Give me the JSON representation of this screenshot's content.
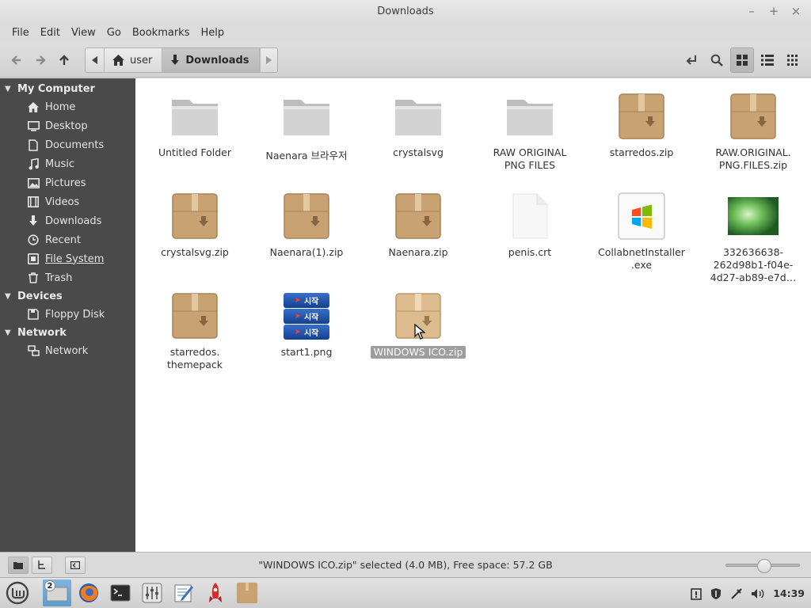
{
  "window": {
    "title": "Downloads",
    "controls": {
      "minimize": "–",
      "maximize": "+",
      "close": "×"
    }
  },
  "menubar": [
    "File",
    "Edit",
    "View",
    "Go",
    "Bookmarks",
    "Help"
  ],
  "toolbar": {
    "breadcrumbs": [
      {
        "label": "user",
        "icon": "home-icon"
      },
      {
        "label": "Downloads",
        "icon": "download-icon"
      }
    ]
  },
  "sidebar": {
    "sections": [
      {
        "title": "My Computer",
        "items": [
          {
            "label": "Home",
            "icon": "home-icon"
          },
          {
            "label": "Desktop",
            "icon": "desktop-icon"
          },
          {
            "label": "Documents",
            "icon": "documents-icon"
          },
          {
            "label": "Music",
            "icon": "music-icon"
          },
          {
            "label": "Pictures",
            "icon": "pictures-icon"
          },
          {
            "label": "Videos",
            "icon": "videos-icon"
          },
          {
            "label": "Downloads",
            "icon": "download-icon"
          },
          {
            "label": "Recent",
            "icon": "recent-icon"
          },
          {
            "label": "File System",
            "icon": "filesystem-icon"
          },
          {
            "label": "Trash",
            "icon": "trash-icon"
          }
        ]
      },
      {
        "title": "Devices",
        "items": [
          {
            "label": "Floppy Disk",
            "icon": "floppy-icon"
          }
        ]
      },
      {
        "title": "Network",
        "items": [
          {
            "label": "Network",
            "icon": "network-icon"
          }
        ]
      }
    ]
  },
  "files": [
    {
      "name": "Untitled Folder",
      "type": "folder"
    },
    {
      "name": "Naenara 브라우저",
      "type": "folder"
    },
    {
      "name": "crystalsvg",
      "type": "folder"
    },
    {
      "name": "RAW ORIGINAL PNG FILES",
      "type": "folder"
    },
    {
      "name": "starredos.zip",
      "type": "archive"
    },
    {
      "name": "RAW.ORIGINAL.\nPNG.FILES.zip",
      "type": "archive"
    },
    {
      "name": "crystalsvg.zip",
      "type": "archive"
    },
    {
      "name": "Naenara(1).zip",
      "type": "archive"
    },
    {
      "name": "Naenara.zip",
      "type": "archive"
    },
    {
      "name": "penis.crt",
      "type": "document"
    },
    {
      "name": "CollabnetInstaller\n.exe",
      "type": "exe"
    },
    {
      "name": "332636638-\n262d98b1-f04e-\n4d27-ab89-e7d…",
      "type": "image"
    },
    {
      "name": "starredos.\nthemepack",
      "type": "archive"
    },
    {
      "name": "start1.png",
      "type": "start-image",
      "button_text": "시작"
    },
    {
      "name": "WINDOWS ICO.zip",
      "type": "archive",
      "selected": true
    }
  ],
  "statusbar": {
    "text": "\"WINDOWS ICO.zip\" selected (4.0 MB), Free space: 57.2 GB",
    "zoom_level": 0.52
  },
  "taskbar": {
    "workspace_badge": "2",
    "clock": "14:39"
  },
  "colors": {
    "sidebar_bg": "#4a4a4a",
    "archive_tan": "#c9a273",
    "folder_grey": "#c8c8c8",
    "selection": "#9e9e9e"
  }
}
